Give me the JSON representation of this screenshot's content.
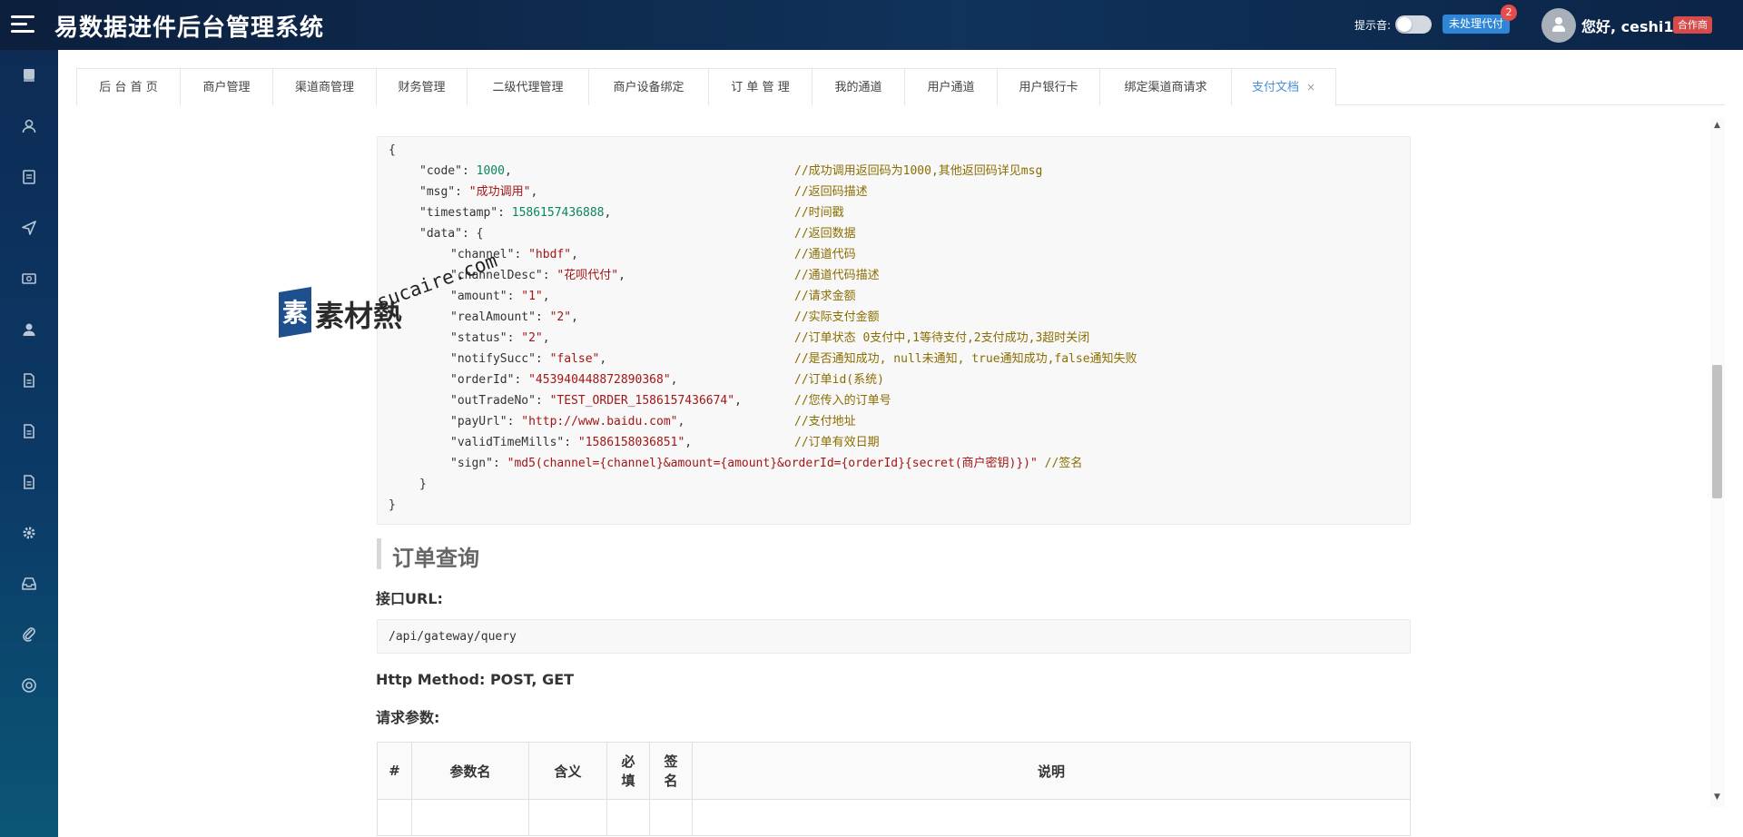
{
  "header": {
    "title": "易数据进件后台管理系统",
    "sound_label": "提示音:",
    "pending_label": "未处理代付",
    "pending_count": "2",
    "greeting": "您好, ceshi1",
    "role_badge": "合作商",
    "bg_color": "#10325b"
  },
  "sidebar": {
    "icons": [
      "book-icon",
      "user-icon",
      "document-icon",
      "send-icon",
      "money-icon",
      "user-solid-icon",
      "file-icon",
      "file-icon",
      "file-icon",
      "gear-icon",
      "inbox-icon",
      "paperclip-icon",
      "lifebuoy-icon"
    ]
  },
  "tabs": [
    {
      "label": "后 台 首 页"
    },
    {
      "label": "商户管理"
    },
    {
      "label": "渠道商管理"
    },
    {
      "label": "财务管理"
    },
    {
      "label": "二级代理管理"
    },
    {
      "label": "商户设备绑定"
    },
    {
      "label": "订 单 管 理"
    },
    {
      "label": "我的通道"
    },
    {
      "label": "用户通道"
    },
    {
      "label": "用户银行卡"
    },
    {
      "label": "绑定渠道商请求"
    },
    {
      "label": "支付文档",
      "close": "×",
      "active": true
    }
  ],
  "watermark": {
    "text": "素材熱",
    "url": "sucaire.com"
  },
  "code": {
    "top_tick": "-",
    "lines": [
      {
        "indent": 0,
        "text": "{"
      },
      {
        "indent": 1,
        "key": "\"code\"",
        "value": "1000",
        "vtype": "n",
        "comma": ",",
        "comment": "//成功调用返回码为1000,其他返回码详见msg"
      },
      {
        "indent": 1,
        "key": "\"msg\"",
        "value": "\"成功调用\"",
        "vtype": "s",
        "comma": ",",
        "comment": "//返回码描述"
      },
      {
        "indent": 1,
        "key": "\"timestamp\"",
        "value": "1586157436888",
        "vtype": "n",
        "comma": ",",
        "comment": "//时间戳"
      },
      {
        "indent": 1,
        "key": "\"data\"",
        "value": "{",
        "vtype": "p",
        "comma": "",
        "comment": "//返回数据"
      },
      {
        "indent": 2,
        "key": "\"channel\"",
        "value": "\"hbdf\"",
        "vtype": "s",
        "comma": ",",
        "comment": "//通道代码"
      },
      {
        "indent": 2,
        "key": "\"channelDesc\"",
        "value": "\"花呗代付\"",
        "vtype": "s",
        "comma": ",",
        "comment": "//通道代码描述"
      },
      {
        "indent": 2,
        "key": "\"amount\"",
        "value": "\"1\"",
        "vtype": "s",
        "comma": ",",
        "comment": "//请求金额"
      },
      {
        "indent": 2,
        "key": "\"realAmount\"",
        "value": "\"2\"",
        "vtype": "s",
        "comma": ",",
        "comment": "//实际支付金额"
      },
      {
        "indent": 2,
        "key": "\"status\"",
        "value": "\"2\"",
        "vtype": "s",
        "comma": ",",
        "comment": "//订单状态 0支付中,1等待支付,2支付成功,3超时关闭"
      },
      {
        "indent": 2,
        "key": "\"notifySucc\"",
        "value": "\"false\"",
        "vtype": "s",
        "comma": ",",
        "comment": "//是否通知成功, null未通知, true通知成功,false通知失败"
      },
      {
        "indent": 2,
        "key": "\"orderId\"",
        "value": "\"453940448872890368\"",
        "vtype": "s",
        "comma": ",",
        "comment": "//订单id(系统)"
      },
      {
        "indent": 2,
        "key": "\"outTradeNo\"",
        "value": "\"TEST_ORDER_1586157436674\"",
        "vtype": "s",
        "comma": ",",
        "comment": "//您传入的订单号"
      },
      {
        "indent": 2,
        "key": "\"payUrl\"",
        "value": "\"http://www.baidu.com\"",
        "vtype": "s",
        "comma": ",",
        "comment": "//支付地址"
      },
      {
        "indent": 2,
        "key": "\"validTimeMills\"",
        "value": "\"1586158036851\"",
        "vtype": "s",
        "comma": ",",
        "comment": "//订单有效日期"
      },
      {
        "indent": 2,
        "key": "\"sign\"",
        "value": "\"md5(channel={channel}&amount={amount}&orderId={orderId}{secret(商户密钥)})\"",
        "vtype": "s",
        "comma": "",
        "comment": "//签名"
      },
      {
        "indent": 1,
        "text": "}"
      },
      {
        "indent": 0,
        "text": "}"
      }
    ]
  },
  "section": {
    "title": "订单查询",
    "url_label": "接口URL:",
    "url": "/api/gateway/query",
    "method_label": "Http Method: POST, GET",
    "params_label": "请求参数:"
  },
  "param_table": {
    "headers": [
      "#",
      "参数名",
      "含义",
      "必填",
      "签名",
      "说明"
    ]
  }
}
